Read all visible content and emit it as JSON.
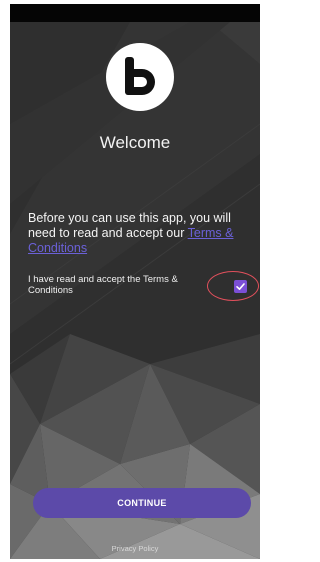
{
  "logo": {
    "icon": "b-logo-icon",
    "color": "#111111"
  },
  "welcome": {
    "title": "Welcome"
  },
  "intro": {
    "text": "Before you can use this app, you will need to read and accept our ",
    "terms_link": "Terms & Conditions"
  },
  "agreement": {
    "label": "I have read and accept the Terms & Conditions",
    "checked": true,
    "checkbox_color": "#7b4fd6"
  },
  "continue_button": {
    "label": "CONTINUE",
    "color": "#5c4aa9"
  },
  "footer": {
    "privacy_label": "Privacy Policy"
  }
}
